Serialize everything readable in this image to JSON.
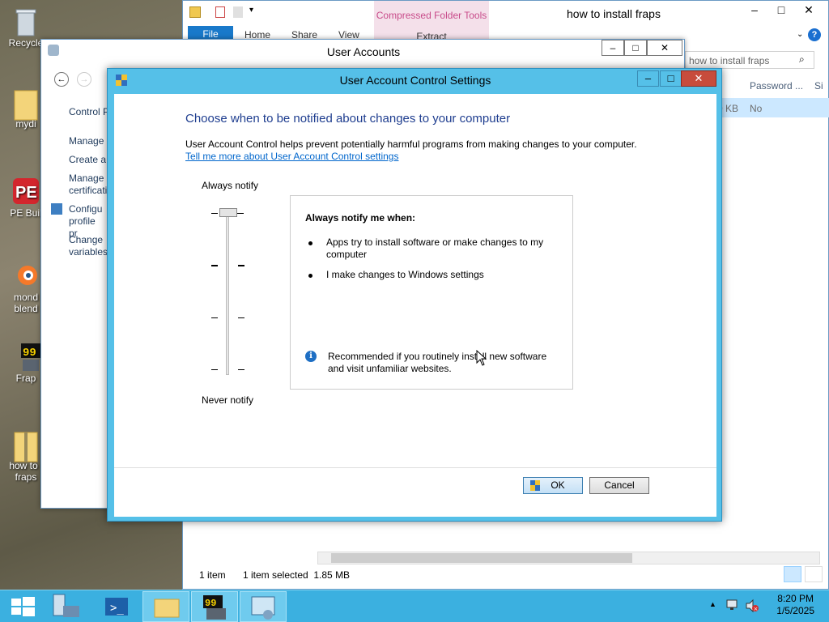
{
  "desktop": {
    "icons": [
      {
        "label": "Recycle",
        "icon": "recycle-bin-icon"
      },
      {
        "label": "mydi",
        "icon": "folder-icon"
      },
      {
        "label": "PE Buil",
        "icon": "pe-builder-icon"
      },
      {
        "label": "mond blend",
        "icon": "blender-icon"
      },
      {
        "label": "Frap",
        "icon": "fraps-icon"
      },
      {
        "label": "how to i fraps",
        "icon": "zip-folder-icon"
      }
    ]
  },
  "explorer": {
    "title": "how to install fraps",
    "contextual_tab": "Compressed Folder Tools",
    "tabs": [
      "File",
      "Home",
      "Share",
      "View"
    ],
    "extract_tab": "Extract",
    "search_placeholder": "how to install fraps",
    "columns": [
      "Password ...",
      "Si"
    ],
    "row_size_fragment": "0 KB",
    "row_password": "No",
    "status_items": "1 item",
    "status_selected": "1 item selected  1.85 MB"
  },
  "user_accounts": {
    "title": "User Accounts",
    "sidebar": [
      "Control P",
      "Manage",
      "Create a",
      "Manage certificati",
      "Configu profile pr",
      "Change variables"
    ]
  },
  "uac": {
    "title": "User Account Control Settings",
    "heading": "Choose when to be notified about changes to your computer",
    "description": "User Account Control helps prevent potentially harmful programs from making changes to your computer.",
    "learn_more": "Tell me more about User Account Control settings",
    "slider_top": "Always notify",
    "slider_bottom": "Never notify",
    "slider_level": 4,
    "slider_levels_total": 4,
    "panel_title": "Always notify me when:",
    "bullets": [
      "Apps try to install software or make changes to my computer",
      "I make changes to Windows settings"
    ],
    "recommendation": "Recommended if you routinely install new software and visit unfamiliar websites.",
    "ok_label": "OK",
    "cancel_label": "Cancel"
  },
  "taskbar": {
    "time": "8:20 PM",
    "date": "1/5/2025"
  },
  "colors": {
    "uac_frame": "#55c0e8",
    "heading": "#1e3d8f",
    "link": "#0066cc",
    "taskbar": "#3bb0e0",
    "close_button": "#c74c3c"
  }
}
